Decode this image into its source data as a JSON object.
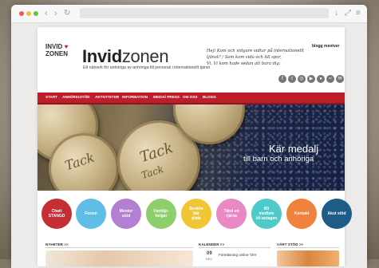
{
  "brand": {
    "logo_line1": "INVID",
    "logo_line2": "ZONEN",
    "title_bold": "Invid",
    "title_rest": "zonen",
    "tagline": "Ett nätverk för anhöriga av anhöriga till personal i internationellt tjänst"
  },
  "header": {
    "blog_link": "blogg mentver",
    "quote_lines": [
      "Hej! Kom och vidgare vidtar på internationellt",
      "tjänst? / Som kom vida och till spar,",
      "Vi. Vi kom hade sedan att bara dig."
    ],
    "social_icons": [
      "facebook-icon",
      "twitter-icon",
      "instagram-icon",
      "youtube-icon",
      "flickr-icon",
      "rss-icon",
      "email-icon"
    ]
  },
  "menu": [
    "START",
    "ANHÖRIGSTÖD",
    "AKTIVITETER",
    "INFORMATION",
    "MEDIA/ PRESS",
    "OM OSS",
    "BLOGG"
  ],
  "hero": {
    "medal_words": [
      "Tack",
      "Tack",
      "Tack"
    ],
    "title": "Kär medalj",
    "subtitle": "till barn och anhöriga"
  },
  "circles": [
    {
      "label": "Chatt\nSTANGD",
      "color": "#c62e35"
    },
    {
      "label": "Forum",
      "color": "#5fbde6"
    },
    {
      "label": "Mentor\nstöd",
      "color": "#b27fd3"
    },
    {
      "label": "Familje-\nhelger",
      "color": "#8dcf6a"
    },
    {
      "label": "Berätta\nhär\nplats",
      "color": "#f1c635"
    },
    {
      "label": "Tänd en\nrjärna",
      "color": "#e889c4"
    },
    {
      "label": "Bli\nmedlem\nbli antagen",
      "color": "#4fc9c9"
    },
    {
      "label": "Kontakt",
      "color": "#f0823d"
    },
    {
      "label": "Akut stöd",
      "color": "#1d5c86"
    }
  ],
  "columns": {
    "news_title": "NYHETER >>",
    "calendar_title": "KALENDER >>",
    "calendar_day": "09",
    "calendar_month": "DEC",
    "calendar_event": "Föreläsning online 'Om'",
    "support_title": "VÄRT STÖD >>"
  }
}
